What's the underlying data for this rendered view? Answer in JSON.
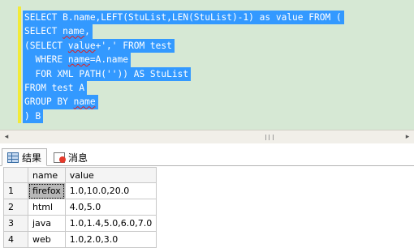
{
  "editor": {
    "lines": [
      "SELECT B.name,LEFT(StuList,LEN(StuList)-1) as value FROM (",
      "SELECT name,",
      "(SELECT value+',' FROM test",
      "  WHERE name=A.name",
      "  FOR XML PATH('')) AS StuList",
      "FROM test A",
      "GROUP BY name",
      ") B"
    ]
  },
  "scrollbar": {
    "left_arrow": "◂",
    "right_arrow": "▸"
  },
  "tabs": {
    "results": "结果",
    "messages": "消息"
  },
  "grid": {
    "columns": [
      "name",
      "value"
    ],
    "rows": [
      {
        "num": "1",
        "name": "firefox",
        "value": "1.0,10.0,20.0"
      },
      {
        "num": "2",
        "name": "html",
        "value": "4.0,5.0"
      },
      {
        "num": "3",
        "name": "java",
        "value": "1.0,1.4,5.0,6.0,7.0"
      },
      {
        "num": "4",
        "name": "web",
        "value": "1.0,2.0,3.0"
      }
    ]
  }
}
